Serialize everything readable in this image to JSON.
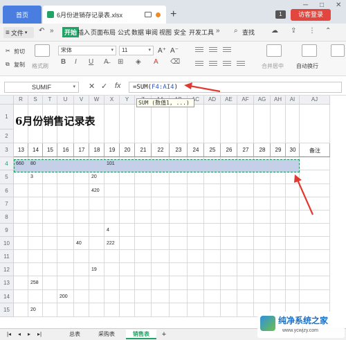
{
  "titlebar": {
    "home_tab": "首页",
    "doc_tab": "6月份进销存记录表.xlsx",
    "new_tab": "+",
    "window_count": "1",
    "login_button": "访客登录",
    "minimize": "─",
    "maximize": "□",
    "close": "✕"
  },
  "ribbon_tabs": {
    "file_menu": "文件",
    "more": "»",
    "items": [
      "开始",
      "插入",
      "页面布局",
      "公式",
      "数据",
      "审阅",
      "视图",
      "安全",
      "开发工具"
    ],
    "search": "查找"
  },
  "ribbon": {
    "cut": "剪切",
    "copy": "复制",
    "format_painter": "格式刷",
    "paste": "粘贴",
    "font_name": "宋体",
    "font_size": "11",
    "bold": "B",
    "italic": "I",
    "underline": "U",
    "merge_center": "合并居中",
    "wrap_text": "自动换行"
  },
  "formula_bar": {
    "name_box": "SUMIF",
    "cancel": "✕",
    "confirm": "✓",
    "fx": "fx",
    "formula_prefix": "=SUM(",
    "formula_range": "F4:AI4",
    "formula_suffix": ")",
    "tooltip": "SUM (数值1, ...)"
  },
  "sheet": {
    "columns": [
      "R",
      "S",
      "T",
      "U",
      "V",
      "W",
      "X",
      "Y",
      "Z",
      "AA",
      "AB",
      "AC",
      "AD",
      "AE",
      "AF",
      "AG",
      "AH",
      "AI",
      "AJ"
    ],
    "rows": [
      "1",
      "2",
      "3",
      "4",
      "5",
      "6",
      "7",
      "8",
      "9",
      "10",
      "11",
      "12",
      "13",
      "14",
      "15"
    ],
    "title": "6月份销售记录表",
    "day_headers": [
      "13",
      "14",
      "15",
      "16",
      "17",
      "18",
      "19",
      "20",
      "21",
      "22",
      "23",
      "24",
      "25",
      "26",
      "27",
      "28",
      "29",
      "30"
    ],
    "remark_header": "备注",
    "values": {
      "r4_c13": "660",
      "r4_c14": "80",
      "r4_c19": "101",
      "r5_c14": "3",
      "r5_c18": "20",
      "r6_c18": "420",
      "r9_c19": "4",
      "r10_c17": "40",
      "r10_c19": "222",
      "r12_c18": "19",
      "r13_c14": "258",
      "r14_c16": "200",
      "r15_c14": "20"
    }
  },
  "sheet_tabs": {
    "tabs": [
      "总表",
      "采购表",
      "销售表"
    ],
    "active": "销售表",
    "add": "+"
  },
  "watermark": {
    "text": "纯净系统之家",
    "url": "www.ycwjzy.com"
  }
}
